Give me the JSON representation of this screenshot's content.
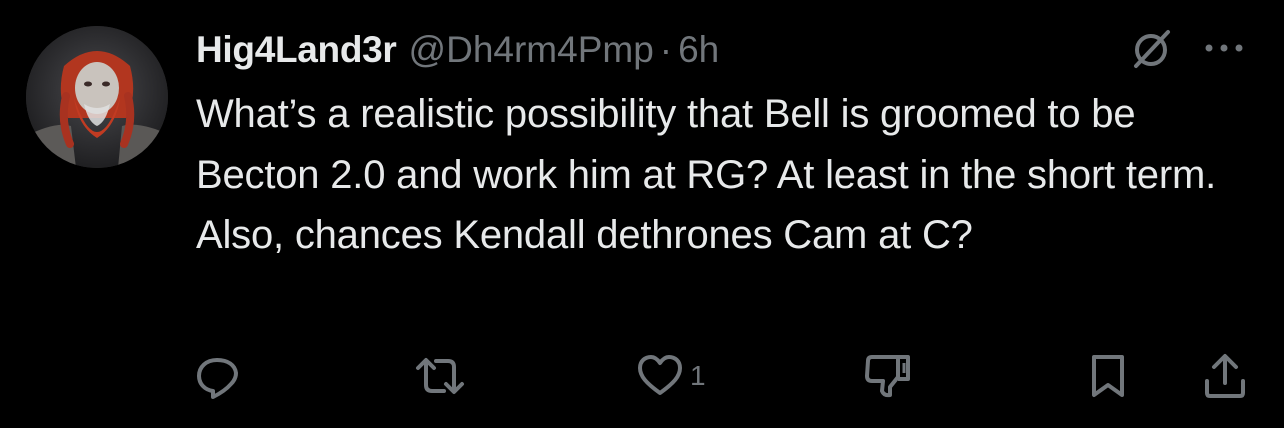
{
  "tweet": {
    "display_name": "Hig4Land3r",
    "handle": "@Dh4rm4Pmp",
    "separator": "·",
    "time": "6h",
    "text": "What’s a realistic possibility that Bell is groomed to be Becton 2.0 and work him at RG? At least in the short term. Also, chances Kendall dethrones Cam at C?"
  },
  "actions": {
    "reply_icon": "reply-icon",
    "retweet_icon": "retweet-icon",
    "like_icon": "heart-icon",
    "like_count": "1",
    "downvote_icon": "thumbs-down-icon",
    "bookmark_icon": "bookmark-icon",
    "share_icon": "share-icon"
  },
  "colors": {
    "background": "#000000",
    "primary_text": "#e7e9ea",
    "secondary_text": "#71767b"
  }
}
